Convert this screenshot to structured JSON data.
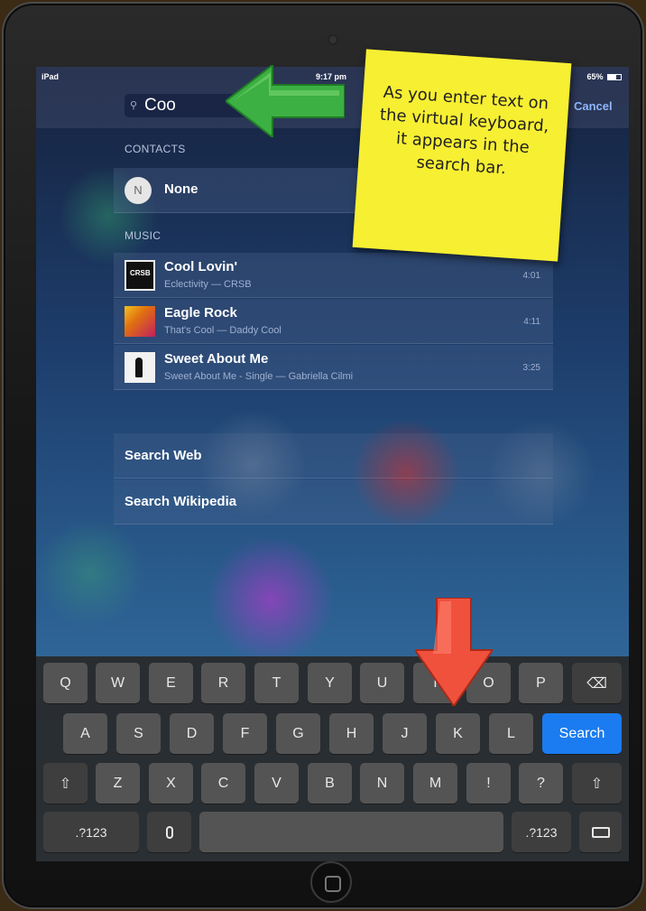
{
  "status": {
    "device": "iPad",
    "time": "9:17 pm",
    "battery": "65%"
  },
  "search": {
    "query": "Coo",
    "cancel_label": "Cancel"
  },
  "contacts": {
    "header": "CONTACTS",
    "items": [
      {
        "initial": "N",
        "name": "None"
      }
    ]
  },
  "music": {
    "header": "MUSIC",
    "items": [
      {
        "title": "Cool Lovin'",
        "subtitle": "Eclectivity  —  CRSB",
        "duration": "4:01"
      },
      {
        "title": "Eagle Rock",
        "subtitle": "That's Cool  —  Daddy Cool",
        "duration": "4:11"
      },
      {
        "title": "Sweet About Me",
        "subtitle": "Sweet About Me - Single  —  Gabriella Cilmi",
        "duration": "3:25"
      }
    ]
  },
  "actions": [
    {
      "label": "Search Web"
    },
    {
      "label": "Search Wikipedia"
    }
  ],
  "keyboard": {
    "row1": [
      "Q",
      "W",
      "E",
      "R",
      "T",
      "Y",
      "U",
      "I",
      "O",
      "P"
    ],
    "row2": [
      "A",
      "S",
      "D",
      "F",
      "G",
      "H",
      "J",
      "K",
      "L"
    ],
    "row3": [
      "Z",
      "X",
      "C",
      "V",
      "B",
      "N",
      "M",
      "!",
      "?"
    ],
    "backspace_glyph": "⌫",
    "shift_glyph": "⇧",
    "search_label": "Search",
    "numbers_label": ".?123",
    "mic_glyph": "🎙",
    "keyboard_glyph": "⌨"
  },
  "annotation": {
    "note_text": "As you enter text on the virtual keyboard, it appears in the search bar."
  },
  "colors": {
    "search_key": "#1a7cf0",
    "note": "#f7ef32",
    "green_arrow": "#3cb043",
    "red_arrow": "#f0513c"
  }
}
